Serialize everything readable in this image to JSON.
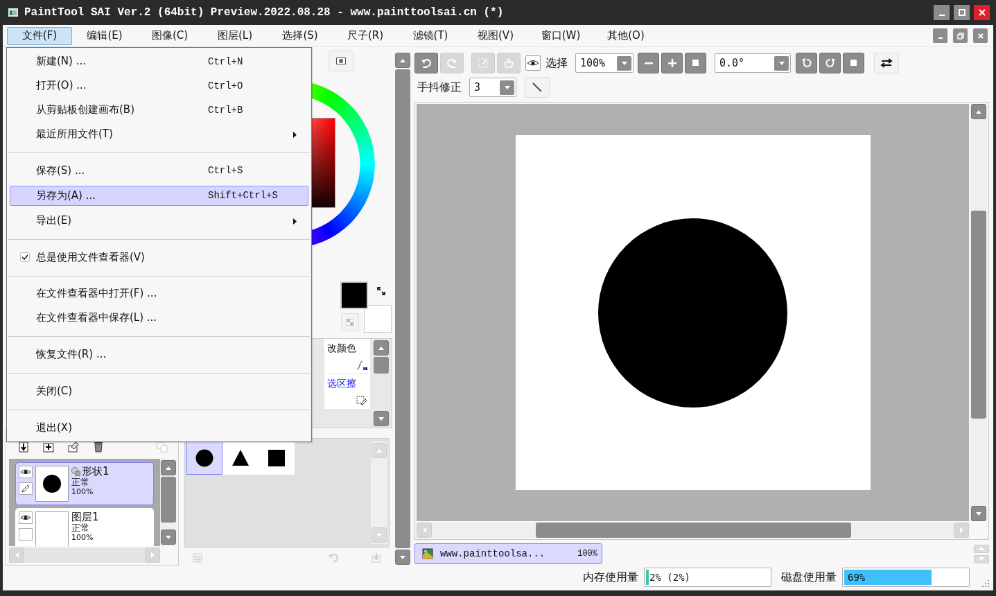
{
  "window": {
    "title": "PaintTool SAI Ver.2 (64bit) Preview.2022.08.28 - www.painttoolsai.cn (*)"
  },
  "menu_bar": [
    {
      "label": "文件(F)",
      "selected": true
    },
    {
      "label": "编辑(E)",
      "selected": false
    },
    {
      "label": "图像(C)",
      "selected": false
    },
    {
      "label": "图层(L)",
      "selected": false
    },
    {
      "label": "选择(S)",
      "selected": false
    },
    {
      "label": "尺子(R)",
      "selected": false
    },
    {
      "label": "滤镜(T)",
      "selected": false
    },
    {
      "label": "视图(V)",
      "selected": false
    },
    {
      "label": "窗口(W)",
      "selected": false
    },
    {
      "label": "其他(O)",
      "selected": false
    }
  ],
  "file_menu": [
    {
      "kind": "item",
      "label": "新建(N) ...",
      "shortcut": "Ctrl+N",
      "selected": false
    },
    {
      "kind": "item",
      "label": "打开(O) ...",
      "shortcut": "Ctrl+O",
      "selected": false
    },
    {
      "kind": "item",
      "label": "从剪贴板创建画布(B)",
      "shortcut": "Ctrl+B",
      "selected": false
    },
    {
      "kind": "submenu",
      "label": "最近所用文件(T)",
      "selected": false
    },
    {
      "kind": "separator"
    },
    {
      "kind": "item",
      "label": "保存(S) ...",
      "shortcut": "Ctrl+S",
      "selected": false
    },
    {
      "kind": "item",
      "label": "另存为(A) ...",
      "shortcut": "Shift+Ctrl+S",
      "selected": true
    },
    {
      "kind": "submenu",
      "label": "导出(E)",
      "selected": false
    },
    {
      "kind": "separator"
    },
    {
      "kind": "check",
      "label": "总是使用文件查看器(V)",
      "checked": true,
      "selected": false
    },
    {
      "kind": "separator"
    },
    {
      "kind": "item",
      "label": "在文件查看器中打开(F) ...",
      "selected": false
    },
    {
      "kind": "item",
      "label": "在文件查看器中保存(L) ...",
      "selected": false
    },
    {
      "kind": "separator"
    },
    {
      "kind": "item",
      "label": "恢复文件(R) ...",
      "selected": false
    },
    {
      "kind": "separator"
    },
    {
      "kind": "item",
      "label": "关闭(C)",
      "selected": false
    },
    {
      "kind": "separator"
    },
    {
      "kind": "item",
      "label": "退出(X)",
      "selected": false
    }
  ],
  "tool_grid": [
    {
      "label": "改颜色",
      "selected": false
    },
    {
      "label": "选区擦",
      "selected": true
    }
  ],
  "layers": [
    {
      "kind": "shape",
      "name": "形状1",
      "blend": "正常",
      "opacity": "100%",
      "selected": true
    },
    {
      "kind": "raster",
      "name": "图层1",
      "blend": "正常",
      "opacity": "100%",
      "selected": false
    }
  ],
  "shapes": [
    {
      "kind": "circle",
      "selected": true
    },
    {
      "kind": "triangle",
      "selected": false
    },
    {
      "kind": "square",
      "selected": false
    }
  ],
  "canvas_toolbar": {
    "edit_buttons": [
      {
        "kind": "undo",
        "disabled": false
      },
      {
        "kind": "redo",
        "disabled": true
      },
      {
        "kind": "crop",
        "disabled": true
      },
      {
        "kind": "clear",
        "disabled": true
      }
    ],
    "selection_label": "选择",
    "zoom": "100%",
    "angle": "0.0°",
    "stabilizer_label": "手抖修正",
    "stabilizer": "3"
  },
  "documents": [
    {
      "name": "www.painttoolsa...",
      "zoom": "100%",
      "selected": true
    }
  ],
  "status": {
    "memory": {
      "label": "内存使用量",
      "reading": "2% (2%)",
      "level": 0.02
    },
    "disk": {
      "label": "磁盘使用量",
      "reading": "69%",
      "level": 0.69
    }
  }
}
